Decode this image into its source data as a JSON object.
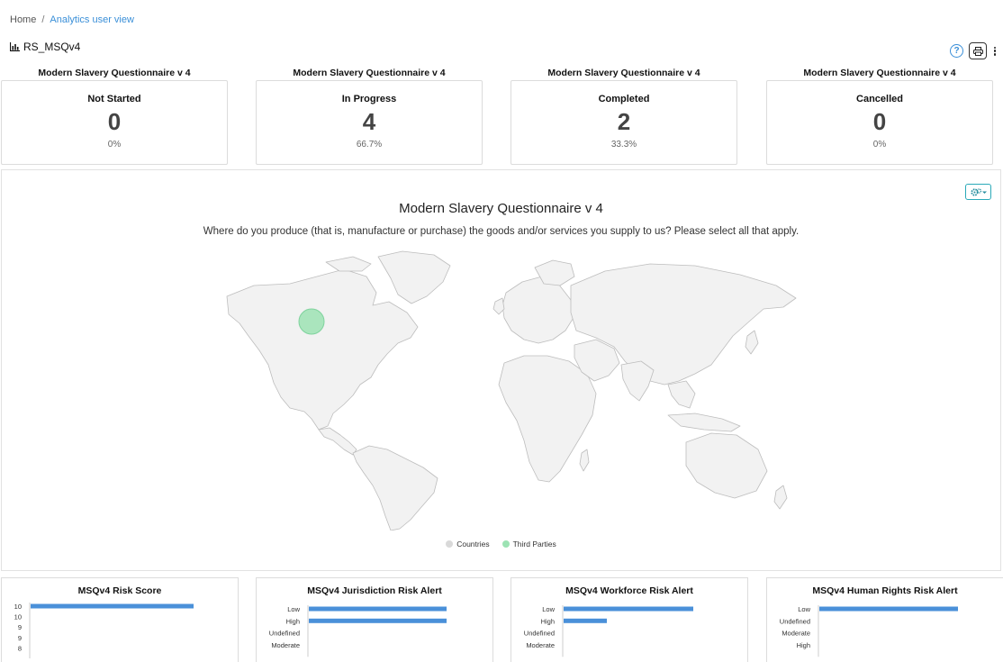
{
  "breadcrumb": {
    "home": "Home",
    "separator": "/",
    "current": "Analytics user view"
  },
  "page": {
    "title": "RS_MSQv4",
    "title_icon": "bar-chart-icon"
  },
  "toolbar": {
    "help_label": "?",
    "help_icon": "help-circle-icon",
    "print_icon": "print-icon",
    "more_icon": "kebab-menu-icon"
  },
  "stats": [
    {
      "header": "Modern Slavery Questionnaire v 4",
      "label": "Not Started",
      "value": "0",
      "percent": "0%"
    },
    {
      "header": "Modern Slavery Questionnaire v 4",
      "label": "In Progress",
      "value": "4",
      "percent": "66.7%"
    },
    {
      "header": "Modern Slavery Questionnaire v 4",
      "label": "Completed",
      "value": "2",
      "percent": "33.3%"
    },
    {
      "header": "Modern Slavery Questionnaire v 4",
      "label": "Cancelled",
      "value": "0",
      "percent": "0%"
    }
  ],
  "map": {
    "title": "Modern Slavery Questionnaire v 4",
    "subtitle": "Where do you produce (that is, manufacture or purchase) the goods and/or services you supply to us? Please select all that apply.",
    "settings_icon": "gears-dropdown-icon",
    "legend": [
      {
        "label": "Countries",
        "color": "#d9d9d9"
      },
      {
        "label": "Third Parties",
        "color": "#9de3b4"
      }
    ],
    "bubble_color": "#9de3b4",
    "land_color": "#f2f2f2",
    "border_color": "#bdbdbd"
  },
  "chart_data": [
    {
      "type": "bar",
      "title": "MSQv4 Risk Score",
      "categories": [
        "10",
        "10",
        "9",
        "9",
        "8"
      ],
      "values": [
        1,
        0,
        0,
        0,
        0
      ],
      "color": "#4a90d9"
    },
    {
      "type": "bar",
      "title": "MSQv4 Jurisdiction Risk Alert",
      "categories": [
        "Low",
        "High",
        "Undefined",
        "Moderate"
      ],
      "values": [
        1,
        1,
        0,
        0
      ],
      "color": "#4a90d9"
    },
    {
      "type": "bar",
      "title": "MSQv4 Workforce Risk Alert",
      "categories": [
        "Low",
        "High",
        "Undefined",
        "Moderate"
      ],
      "values": [
        3,
        1,
        0,
        0
      ],
      "color": "#4a90d9"
    },
    {
      "type": "bar",
      "title": "MSQv4 Human Rights Risk Alert",
      "categories": [
        "Low",
        "Undefined",
        "Moderate",
        "High"
      ],
      "values": [
        1,
        0,
        0,
        0
      ],
      "color": "#4a90d9"
    }
  ]
}
